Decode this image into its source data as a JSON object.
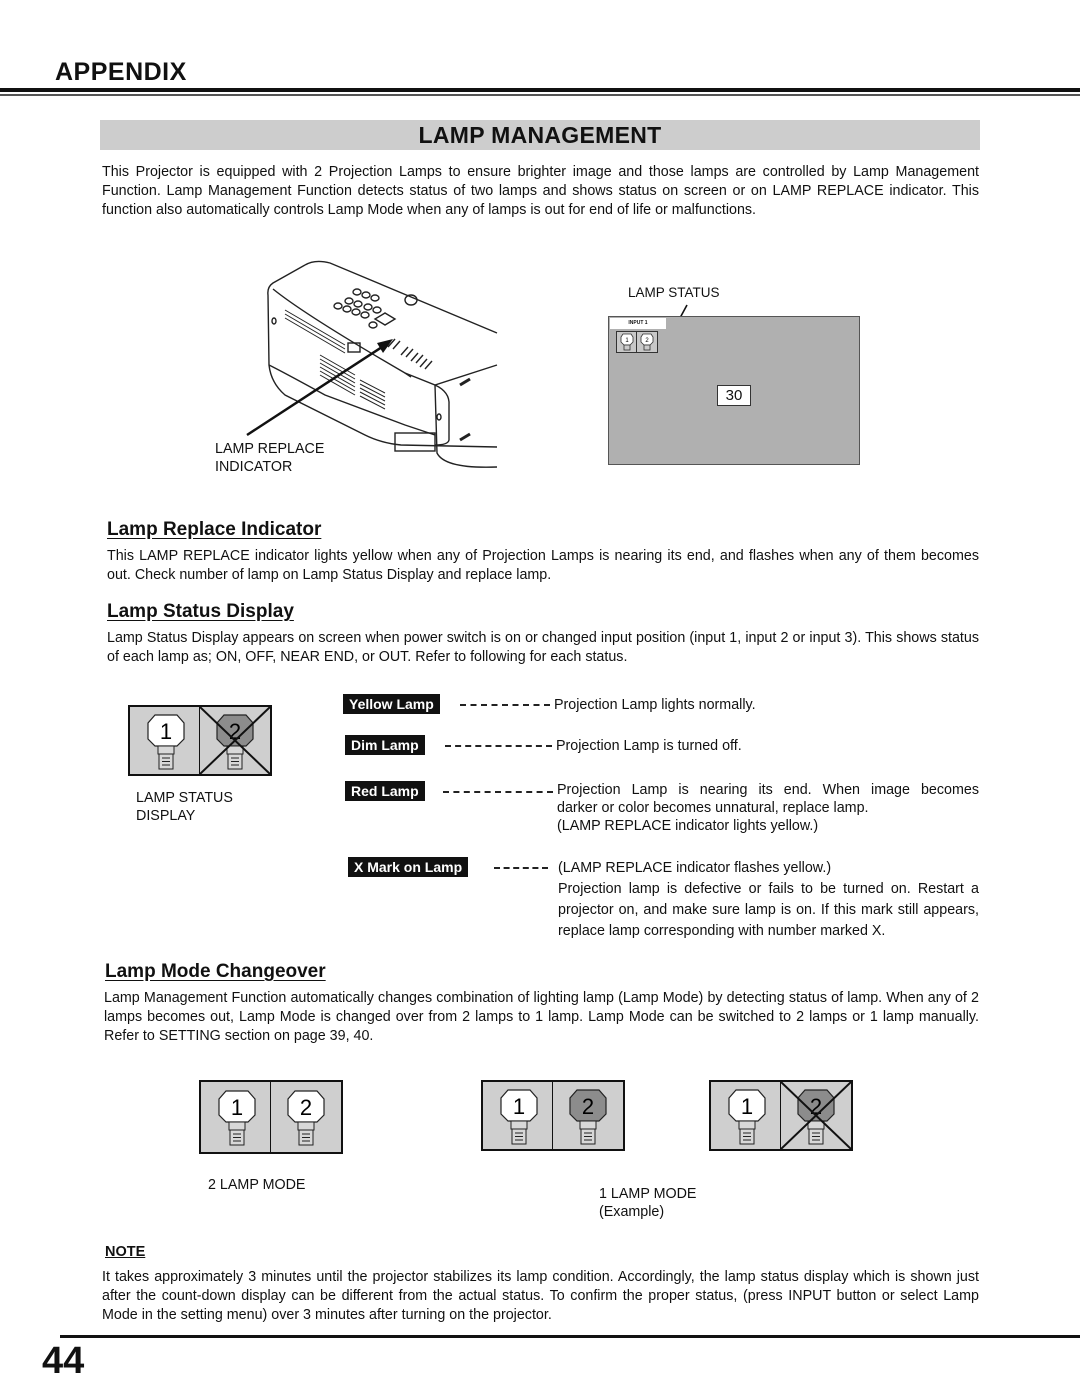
{
  "header": {
    "section": "APPENDIX",
    "title": "LAMP MANAGEMENT"
  },
  "intro": "This Projector is equipped with 2 Projection Lamps to ensure brighter image and those lamps are controlled by Lamp Management Function.  Lamp Management Function detects status of two lamps and shows status on screen or on LAMP REPLACE indicator.  This function also automatically controls Lamp Mode when any of lamps is out for end of life or malfunctions.",
  "figure_top": {
    "projector_label_line1": "LAMP REPLACE",
    "projector_label_line2": "INDICATOR",
    "screen_label": "LAMP STATUS",
    "screen_input_tab": "INPUT 1",
    "screen_countdown": "30",
    "screen_lamps": [
      "1",
      "2"
    ]
  },
  "lamp_replace": {
    "heading": "Lamp Replace Indicator",
    "body": "This LAMP REPLACE indicator lights yellow when any of Projection Lamps is nearing its end, and flashes when any of them becomes out.  Check number of lamp on Lamp Status Display and replace lamp."
  },
  "lamp_status": {
    "heading": "Lamp Status Display",
    "body": "Lamp Status Display appears on screen when power switch is on or changed input position (input 1, input 2 or input 3). This shows status of each lamp as; ON, OFF, NEAR END, or OUT.  Refer to following for each status.",
    "display_caption_line1": "LAMP STATUS",
    "display_caption_line2": "DISPLAY",
    "display_lamps": [
      "1",
      "2"
    ],
    "legend": [
      {
        "tag": "Yellow Lamp",
        "lines": [
          "Projection Lamp lights normally."
        ]
      },
      {
        "tag": "Dim Lamp",
        "lines": [
          "Projection Lamp is turned off."
        ]
      },
      {
        "tag": "Red Lamp",
        "lines": [
          "Projection Lamp is nearing its end.  When image becomes",
          "darker or color becomes unnatural, replace lamp.",
          "(LAMP REPLACE indicator lights yellow.)"
        ]
      },
      {
        "tag": "X Mark on Lamp",
        "lines": [
          "(LAMP REPLACE indicator flashes yellow.)",
          "Projection lamp is defective or fails to be turned on. Restart a projector on, and make sure lamp is on. If this mark still appears, replace lamp corresponding with number marked X."
        ]
      }
    ]
  },
  "lamp_mode": {
    "heading": "Lamp Mode Changeover",
    "body": "Lamp Management Function automatically changes combination of lighting lamp (Lamp Mode) by detecting status of lamp. When any of 2 lamps becomes out, Lamp Mode is changed over from 2 lamps to 1 lamp. Lamp Mode can be switched to 2 lamps or 1 lamp manually.  Refer to SETTING section on page 39, 40.",
    "lamps": [
      "1",
      "2"
    ],
    "caption_2lamp": "2 LAMP MODE",
    "caption_1lamp_line1": "1 LAMP MODE",
    "caption_1lamp_line2": "(Example)"
  },
  "note": {
    "heading": "NOTE",
    "body": "It takes approximately 3 minutes until the projector stabilizes its lamp condition. Accordingly, the lamp status display which is shown just after the count-down display can be different from the actual status. To confirm the proper status, (press INPUT button or select Lamp Mode in the setting menu) over 3 minutes after turning on the projector."
  },
  "page_number": "44",
  "colors": {
    "title_bar": "#cdcdcd",
    "screen_bg": "#b0b0b0",
    "lamp_box_bg": "#cfcfcf",
    "lamp_on": "#ffffff",
    "lamp_off": "#8c8c8c",
    "tag_bg": "#111111"
  }
}
